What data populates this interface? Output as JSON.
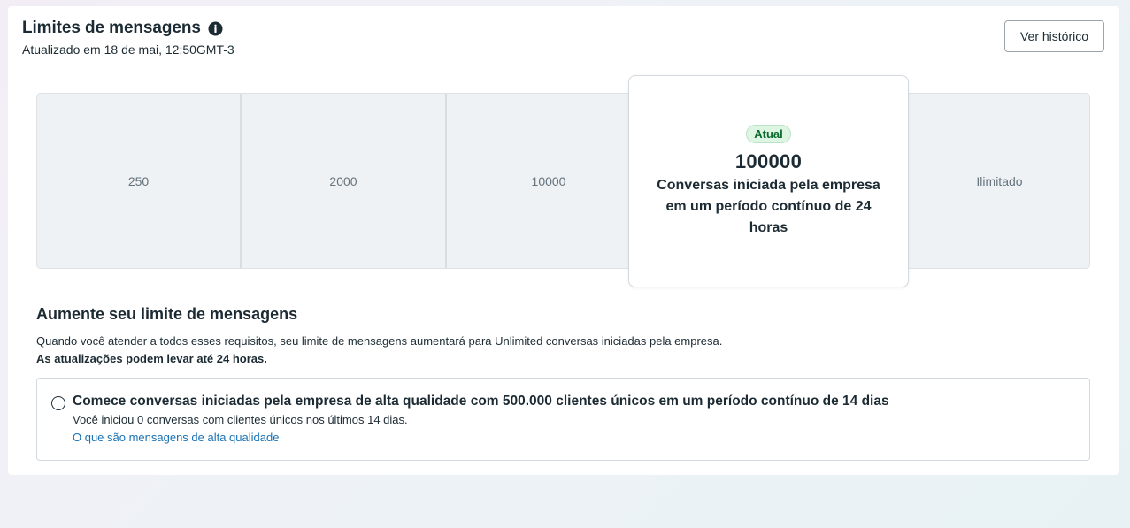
{
  "header": {
    "title": "Limites de mensagens",
    "updated": "Atualizado em 18 de mai, 12:50GMT-3",
    "history_button": "Ver histórico"
  },
  "tiers": {
    "items": [
      "250",
      "2000",
      "10000",
      "100000",
      "Ilimitado"
    ],
    "current": {
      "badge": "Atual",
      "value": "100000",
      "description": "Conversas iniciada pela empresa em um período contínuo de 24 horas"
    }
  },
  "increase": {
    "title": "Aumente seu limite de mensagens",
    "description": "Quando você atender a todos esses requisitos, seu limite de mensagens aumentará para Unlimited conversas iniciadas pela empresa.",
    "note": "As atualizações podem levar até 24 horas."
  },
  "requirement": {
    "title": "Comece conversas iniciadas pela empresa de alta qualidade com 500.000 clientes únicos em um período contínuo de 14 dias",
    "subtitle": "Você iniciou 0 conversas com clientes únicos nos últimos 14 dias.",
    "link": "O que são mensagens de alta qualidade"
  },
  "colors": {
    "badge_bg": "#dff5e3",
    "badge_text": "#0a6a2e",
    "link": "#1a73b5"
  }
}
